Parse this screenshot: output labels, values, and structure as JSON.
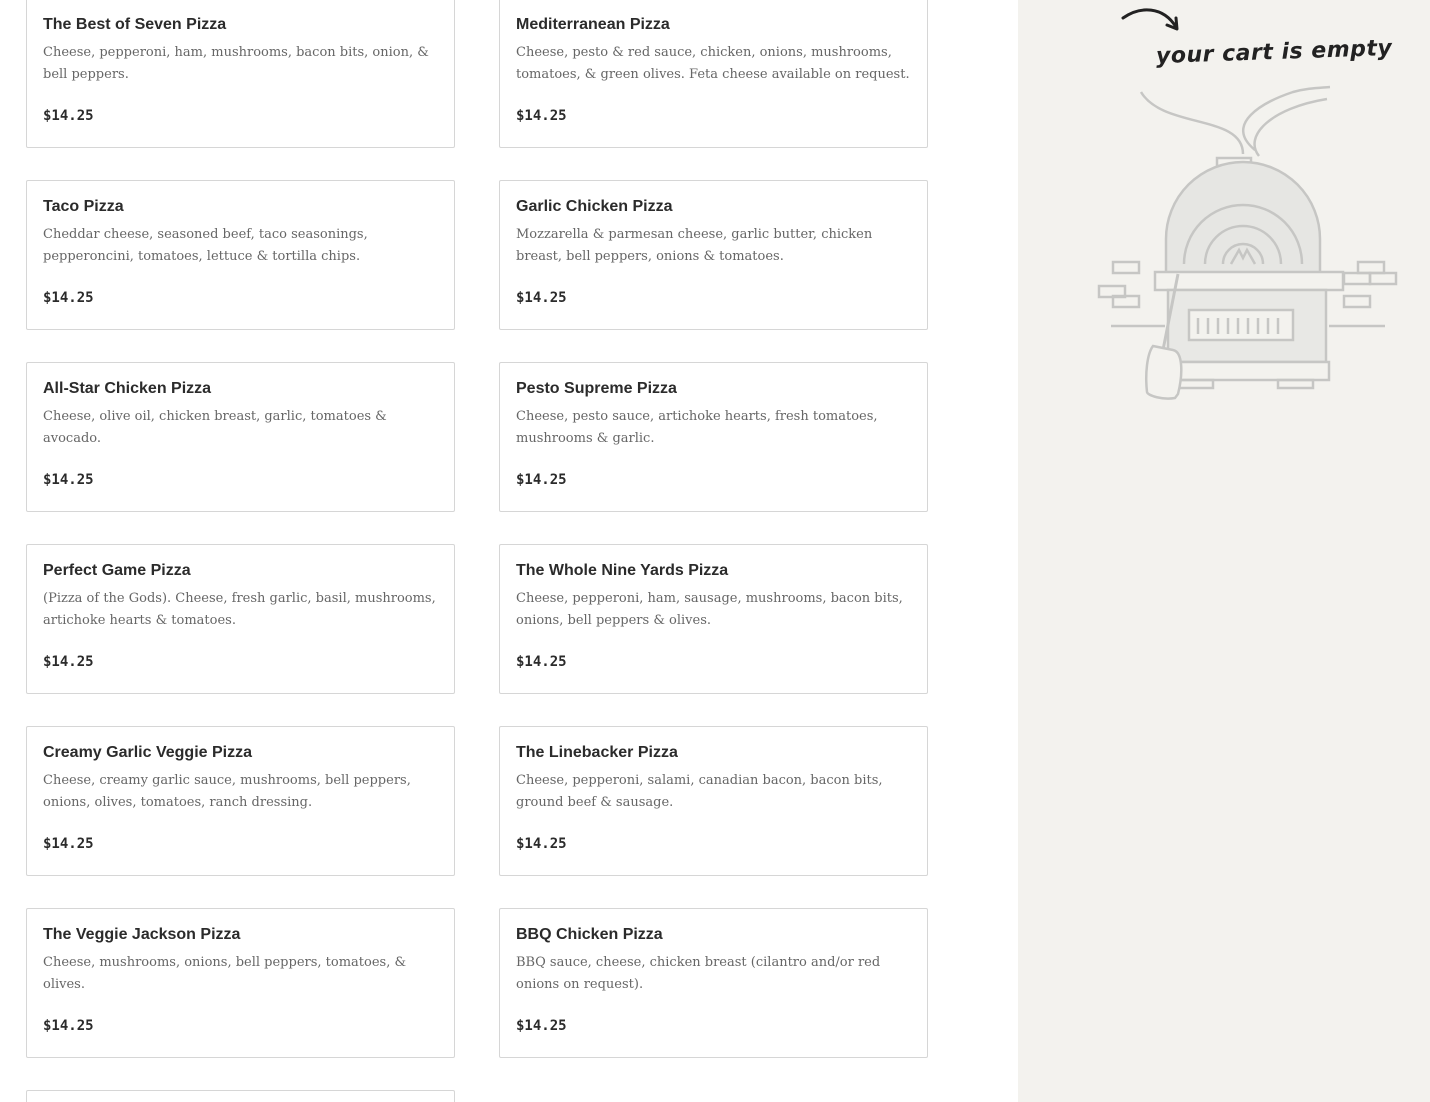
{
  "menu": {
    "items": [
      {
        "name": "The Best of Seven Pizza",
        "description": "Cheese, pepperoni, ham, mushrooms, bacon bits, onion, & bell peppers.",
        "price": "$14.25"
      },
      {
        "name": "Mediterranean Pizza",
        "description": "Cheese, pesto & red sauce, chicken, onions, mushrooms, tomatoes, & green olives. Feta cheese available on request.",
        "price": "$14.25"
      },
      {
        "name": "Taco Pizza",
        "description": "Cheddar cheese, seasoned beef, taco seasonings, pepperoncini, tomatoes, lettuce & tortilla chips.",
        "price": "$14.25"
      },
      {
        "name": "Garlic Chicken Pizza",
        "description": "Mozzarella & parmesan cheese, garlic butter, chicken breast, bell peppers, onions & tomatoes.",
        "price": "$14.25"
      },
      {
        "name": "All-Star Chicken Pizza",
        "description": "Cheese, olive oil, chicken breast, garlic, tomatoes & avocado.",
        "price": "$14.25"
      },
      {
        "name": "Pesto Supreme Pizza",
        "description": "Cheese, pesto sauce, artichoke hearts, fresh tomatoes, mushrooms & garlic.",
        "price": "$14.25"
      },
      {
        "name": "Perfect Game Pizza",
        "description": "(Pizza of the Gods). Cheese, fresh garlic, basil, mushrooms, artichoke hearts & tomatoes.",
        "price": "$14.25"
      },
      {
        "name": "The Whole Nine Yards Pizza",
        "description": "Cheese, pepperoni, ham, sausage, mushrooms, bacon bits, onions, bell peppers & olives.",
        "price": "$14.25"
      },
      {
        "name": "Creamy Garlic Veggie Pizza",
        "description": "Cheese, creamy garlic sauce, mushrooms, bell peppers, onions, olives, tomatoes, ranch dressing.",
        "price": "$14.25"
      },
      {
        "name": "The Linebacker Pizza",
        "description": "Cheese, pepperoni, salami, canadian bacon, bacon bits, ground beef & sausage.",
        "price": "$14.25"
      },
      {
        "name": "The Veggie Jackson Pizza",
        "description": "Cheese, mushrooms, onions, bell peppers, tomatoes, & olives.",
        "price": "$14.25"
      },
      {
        "name": "BBQ Chicken Pizza",
        "description": "BBQ sauce, cheese, chicken breast (cilantro and/or red onions on request).",
        "price": "$14.25"
      }
    ]
  },
  "cart": {
    "empty_label": "your cart is empty",
    "illustration_icon": "pizza-oven-icon",
    "arrow_icon": "curved-arrow-icon"
  },
  "colors": {
    "cart_background": "#f3f2ee",
    "card_border": "#d6d6d6",
    "text_primary": "#2b2b2b",
    "text_secondary": "#666666"
  }
}
